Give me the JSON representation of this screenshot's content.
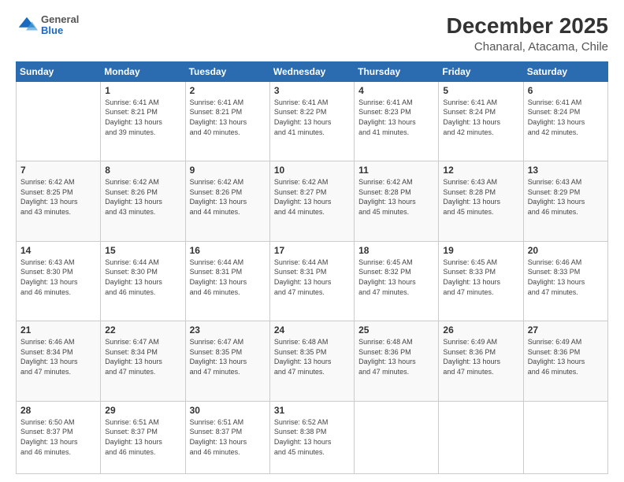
{
  "header": {
    "logo_general": "General",
    "logo_blue": "Blue",
    "title": "December 2025",
    "subtitle": "Chanaral, Atacama, Chile"
  },
  "calendar": {
    "columns": [
      "Sunday",
      "Monday",
      "Tuesday",
      "Wednesday",
      "Thursday",
      "Friday",
      "Saturday"
    ],
    "weeks": [
      {
        "days": [
          {
            "num": "",
            "info": ""
          },
          {
            "num": "1",
            "info": "Sunrise: 6:41 AM\nSunset: 8:21 PM\nDaylight: 13 hours\nand 39 minutes."
          },
          {
            "num": "2",
            "info": "Sunrise: 6:41 AM\nSunset: 8:21 PM\nDaylight: 13 hours\nand 40 minutes."
          },
          {
            "num": "3",
            "info": "Sunrise: 6:41 AM\nSunset: 8:22 PM\nDaylight: 13 hours\nand 41 minutes."
          },
          {
            "num": "4",
            "info": "Sunrise: 6:41 AM\nSunset: 8:23 PM\nDaylight: 13 hours\nand 41 minutes."
          },
          {
            "num": "5",
            "info": "Sunrise: 6:41 AM\nSunset: 8:24 PM\nDaylight: 13 hours\nand 42 minutes."
          },
          {
            "num": "6",
            "info": "Sunrise: 6:41 AM\nSunset: 8:24 PM\nDaylight: 13 hours\nand 42 minutes."
          }
        ]
      },
      {
        "days": [
          {
            "num": "7",
            "info": "Sunrise: 6:42 AM\nSunset: 8:25 PM\nDaylight: 13 hours\nand 43 minutes."
          },
          {
            "num": "8",
            "info": "Sunrise: 6:42 AM\nSunset: 8:26 PM\nDaylight: 13 hours\nand 43 minutes."
          },
          {
            "num": "9",
            "info": "Sunrise: 6:42 AM\nSunset: 8:26 PM\nDaylight: 13 hours\nand 44 minutes."
          },
          {
            "num": "10",
            "info": "Sunrise: 6:42 AM\nSunset: 8:27 PM\nDaylight: 13 hours\nand 44 minutes."
          },
          {
            "num": "11",
            "info": "Sunrise: 6:42 AM\nSunset: 8:28 PM\nDaylight: 13 hours\nand 45 minutes."
          },
          {
            "num": "12",
            "info": "Sunrise: 6:43 AM\nSunset: 8:28 PM\nDaylight: 13 hours\nand 45 minutes."
          },
          {
            "num": "13",
            "info": "Sunrise: 6:43 AM\nSunset: 8:29 PM\nDaylight: 13 hours\nand 46 minutes."
          }
        ]
      },
      {
        "days": [
          {
            "num": "14",
            "info": "Sunrise: 6:43 AM\nSunset: 8:30 PM\nDaylight: 13 hours\nand 46 minutes."
          },
          {
            "num": "15",
            "info": "Sunrise: 6:44 AM\nSunset: 8:30 PM\nDaylight: 13 hours\nand 46 minutes."
          },
          {
            "num": "16",
            "info": "Sunrise: 6:44 AM\nSunset: 8:31 PM\nDaylight: 13 hours\nand 46 minutes."
          },
          {
            "num": "17",
            "info": "Sunrise: 6:44 AM\nSunset: 8:31 PM\nDaylight: 13 hours\nand 47 minutes."
          },
          {
            "num": "18",
            "info": "Sunrise: 6:45 AM\nSunset: 8:32 PM\nDaylight: 13 hours\nand 47 minutes."
          },
          {
            "num": "19",
            "info": "Sunrise: 6:45 AM\nSunset: 8:33 PM\nDaylight: 13 hours\nand 47 minutes."
          },
          {
            "num": "20",
            "info": "Sunrise: 6:46 AM\nSunset: 8:33 PM\nDaylight: 13 hours\nand 47 minutes."
          }
        ]
      },
      {
        "days": [
          {
            "num": "21",
            "info": "Sunrise: 6:46 AM\nSunset: 8:34 PM\nDaylight: 13 hours\nand 47 minutes."
          },
          {
            "num": "22",
            "info": "Sunrise: 6:47 AM\nSunset: 8:34 PM\nDaylight: 13 hours\nand 47 minutes."
          },
          {
            "num": "23",
            "info": "Sunrise: 6:47 AM\nSunset: 8:35 PM\nDaylight: 13 hours\nand 47 minutes."
          },
          {
            "num": "24",
            "info": "Sunrise: 6:48 AM\nSunset: 8:35 PM\nDaylight: 13 hours\nand 47 minutes."
          },
          {
            "num": "25",
            "info": "Sunrise: 6:48 AM\nSunset: 8:36 PM\nDaylight: 13 hours\nand 47 minutes."
          },
          {
            "num": "26",
            "info": "Sunrise: 6:49 AM\nSunset: 8:36 PM\nDaylight: 13 hours\nand 47 minutes."
          },
          {
            "num": "27",
            "info": "Sunrise: 6:49 AM\nSunset: 8:36 PM\nDaylight: 13 hours\nand 46 minutes."
          }
        ]
      },
      {
        "days": [
          {
            "num": "28",
            "info": "Sunrise: 6:50 AM\nSunset: 8:37 PM\nDaylight: 13 hours\nand 46 minutes."
          },
          {
            "num": "29",
            "info": "Sunrise: 6:51 AM\nSunset: 8:37 PM\nDaylight: 13 hours\nand 46 minutes."
          },
          {
            "num": "30",
            "info": "Sunrise: 6:51 AM\nSunset: 8:37 PM\nDaylight: 13 hours\nand 46 minutes."
          },
          {
            "num": "31",
            "info": "Sunrise: 6:52 AM\nSunset: 8:38 PM\nDaylight: 13 hours\nand 45 minutes."
          },
          {
            "num": "",
            "info": ""
          },
          {
            "num": "",
            "info": ""
          },
          {
            "num": "",
            "info": ""
          }
        ]
      }
    ]
  }
}
